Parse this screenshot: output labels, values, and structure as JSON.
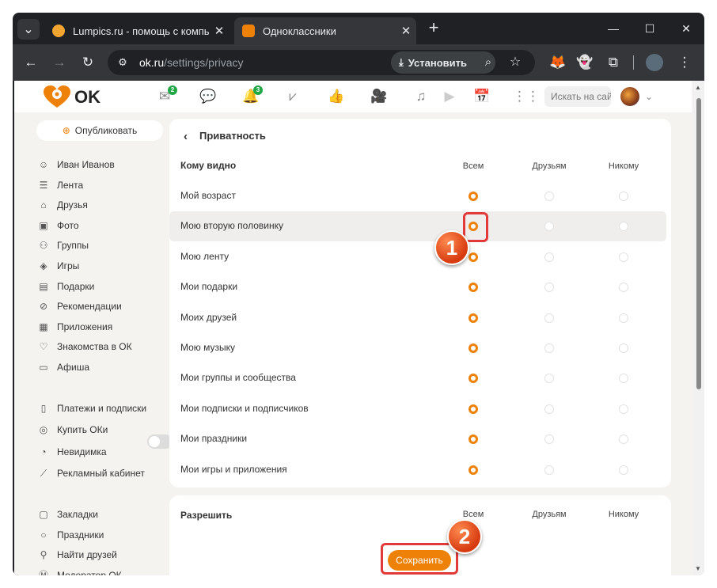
{
  "tabs": [
    {
      "title": "Lumpics.ru - помощь с компьютером",
      "close": "✕"
    },
    {
      "title": "Одноклассники",
      "close": "✕"
    }
  ],
  "new_tab": "+",
  "window_controls": {
    "minimize": "—",
    "maximize": "☐",
    "close": "✕"
  },
  "toolbar": {
    "url_host": "ok.ru",
    "url_path": "/settings/privacy",
    "install_label": "Установить"
  },
  "ok": {
    "logo_text": "OK",
    "messages_badge": "2",
    "notifications_badge": "3",
    "search_placeholder": "Искать на сайте"
  },
  "sidebar": {
    "publish_label": "Опубликовать",
    "items": [
      {
        "label": "Иван Иванов",
        "icon": "user-icon"
      },
      {
        "label": "Лента",
        "icon": "feed-icon"
      },
      {
        "label": "Друзья",
        "icon": "friends-icon"
      },
      {
        "label": "Фото",
        "icon": "photo-icon"
      },
      {
        "label": "Группы",
        "icon": "groups-icon"
      },
      {
        "label": "Игры",
        "icon": "games-icon"
      },
      {
        "label": "Подарки",
        "icon": "gift-icon"
      },
      {
        "label": "Рекомендации",
        "icon": "compass-icon"
      },
      {
        "label": "Приложения",
        "icon": "apps-icon"
      },
      {
        "label": "Знакомства в ОК",
        "icon": "heart-icon"
      },
      {
        "label": "Афиша",
        "icon": "ticket-icon"
      }
    ],
    "items2": [
      {
        "label": "Платежи и подписки",
        "icon": "wallet-icon"
      },
      {
        "label": "Купить ОКи",
        "icon": "coin-icon"
      },
      {
        "label": "Невидимка",
        "icon": "ghost-icon"
      },
      {
        "label": "Рекламный кабинет",
        "icon": "megaphone-icon"
      }
    ],
    "items3": [
      {
        "label": "Закладки",
        "icon": "bookmark-icon"
      },
      {
        "label": "Праздники",
        "icon": "balloon-icon"
      },
      {
        "label": "Найти друзей",
        "icon": "add-user-icon"
      },
      {
        "label": "Модератор ОК",
        "icon": "moderator-icon"
      }
    ],
    "invisible_toggle": false
  },
  "privacy": {
    "title": "Приватность",
    "section": "Кому видно",
    "columns": [
      "Всем",
      "Друзьям",
      "Никому"
    ],
    "rows": [
      {
        "label": "Мой возраст",
        "selected": 0
      },
      {
        "label": "Мою вторую половинку",
        "selected": 0
      },
      {
        "label": "Мою ленту",
        "selected": 0
      },
      {
        "label": "Мои подарки",
        "selected": 0
      },
      {
        "label": "Моих друзей",
        "selected": 0
      },
      {
        "label": "Мою музыку",
        "selected": 0
      },
      {
        "label": "Мои группы и сообщества",
        "selected": 0
      },
      {
        "label": "Мои подписки и подписчиков",
        "selected": 0
      },
      {
        "label": "Мои праздники",
        "selected": 0
      },
      {
        "label": "Мои игры и приложения",
        "selected": 0
      }
    ],
    "allow_section": "Разрешить",
    "save_label": "Сохранить"
  },
  "annotations": [
    "1",
    "2"
  ],
  "colors": {
    "accent": "#ee8208",
    "annotation": "#e23a3a"
  }
}
